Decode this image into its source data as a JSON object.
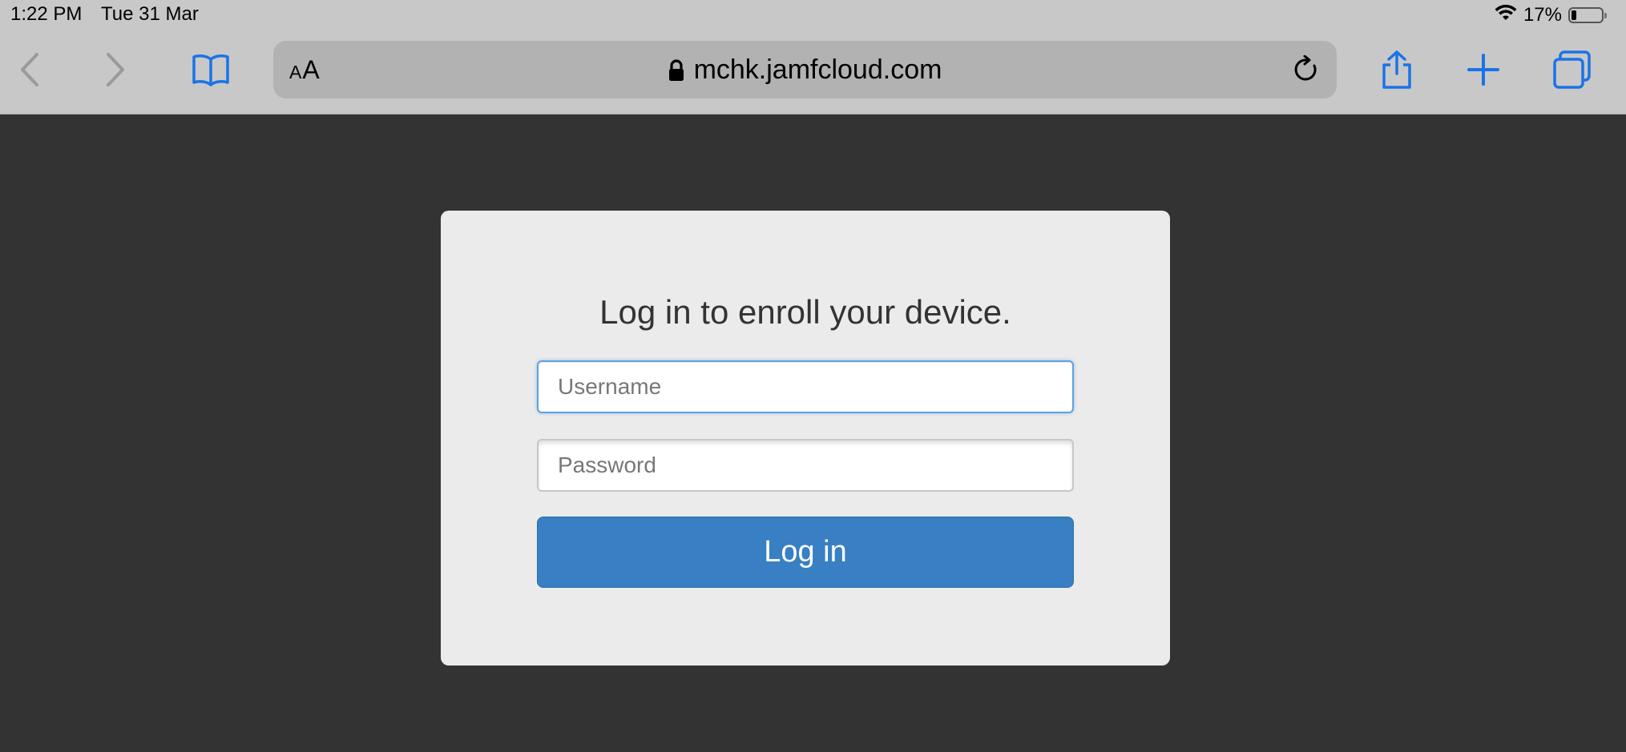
{
  "status_bar": {
    "time": "1:22 PM",
    "date": "Tue 31 Mar",
    "battery_text": "17%",
    "battery_level": 0.17,
    "wifi_icon": "wifi-icon"
  },
  "toolbar": {
    "back_icon": "chevron-left-icon",
    "forward_icon": "chevron-right-icon",
    "bookmarks_icon": "book-icon",
    "text_size_label_small": "A",
    "text_size_label_large": "A",
    "url": "mchk.jamfcloud.com",
    "lock_icon": "lock-icon",
    "reload_icon": "reload-icon",
    "share_icon": "share-icon",
    "new_tab_icon": "plus-icon",
    "tabs_icon": "tabs-icon",
    "accent_color": "#1a73e8"
  },
  "login": {
    "title": "Log in to enroll your device.",
    "username_placeholder": "Username",
    "password_placeholder": "Password",
    "button_label": "Log in",
    "button_color": "#387fc3"
  }
}
